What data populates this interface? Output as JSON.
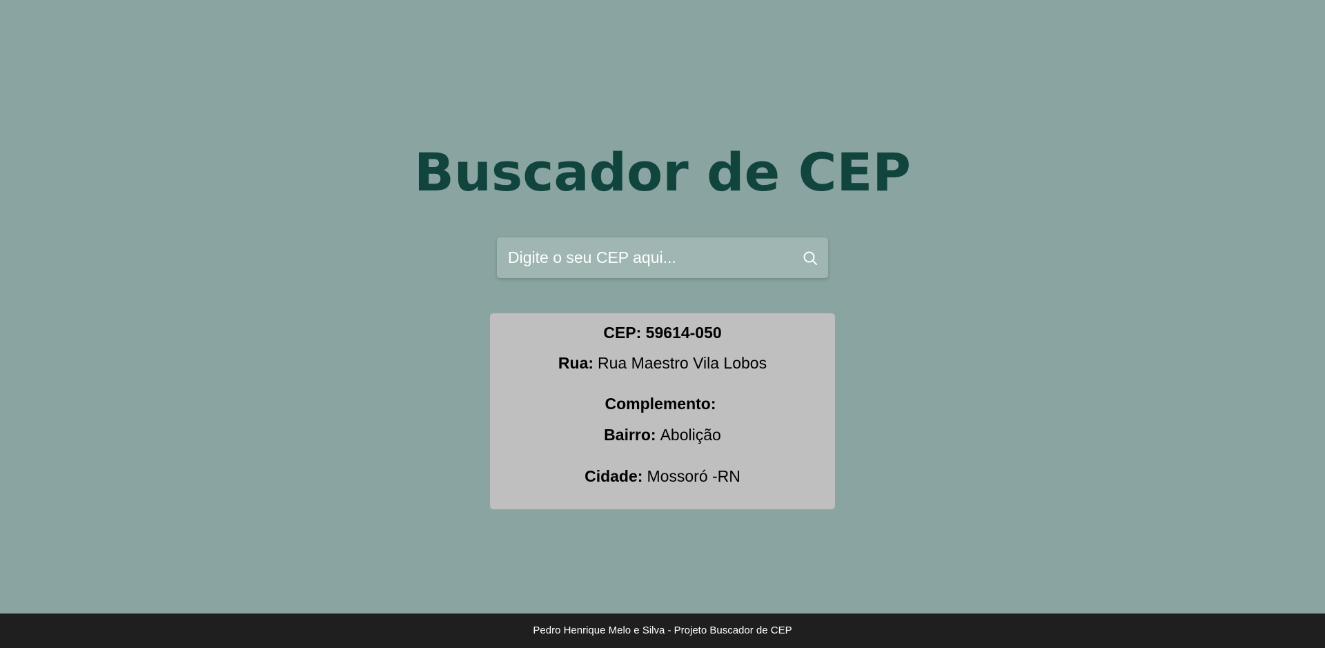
{
  "header": {
    "title": "Buscador de CEP"
  },
  "search": {
    "placeholder": "Digite o seu CEP aqui...",
    "value": "",
    "button_icon": "search-icon"
  },
  "result": {
    "cep_label": "CEP:",
    "cep_value": "59614-050",
    "rua_label": "Rua:",
    "rua_value": "Rua Maestro Vila Lobos",
    "complemento_label": "Complemento:",
    "complemento_value": "",
    "bairro_label": "Bairro:",
    "bairro_value": "Abolição",
    "cidade_label": "Cidade:",
    "cidade_value": "Mossoró -RN"
  },
  "footer": {
    "text": "Pedro Henrique Melo e Silva - Projeto Buscador de CEP"
  },
  "colors": {
    "background": "#8aa5a1",
    "title": "#11443d",
    "search_box": "#9fb6b3",
    "card": "#bfbfbf",
    "footer": "#1f1f1f"
  }
}
